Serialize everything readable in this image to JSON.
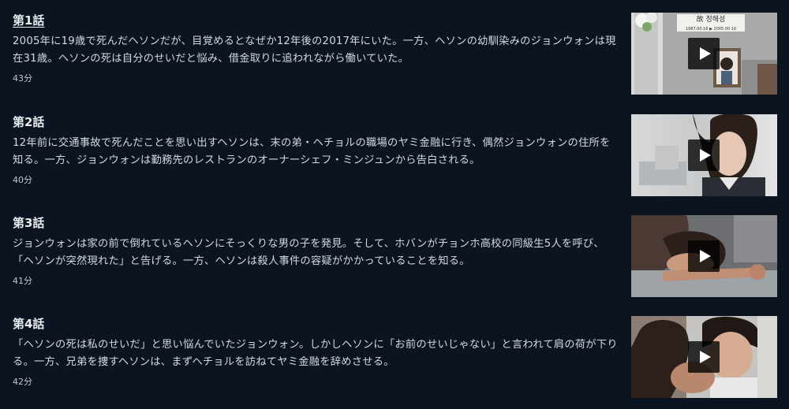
{
  "episodes": [
    {
      "title": "第1話",
      "description": "2005年に19歳で死んだヘソンだが、目覚めるとなぜか12年後の2017年にいた。一方、ヘソンの幼馴染みのジョンウォンは現在31歳。ヘソンの死は自分のせいだと悩み、借金取りに追われながら働いていた。",
      "duration": "43分",
      "thumbnail_plaque": "故 정해성",
      "thumbnail_dates": "1987.00.16 ▶ 2005.00.16"
    },
    {
      "title": "第2話",
      "description": "12年前に交通事故で死んだことを思い出すヘソンは、末の弟・ヘチョルの職場のヤミ金融に行き、偶然ジョンウォンの住所を知る。一方、ジョンウォンは勤務先のレストランのオーナーシェフ・ミンジュンから告白される。",
      "duration": "40分"
    },
    {
      "title": "第3話",
      "description": "ジョンウォンは家の前で倒れているヘソンにそっくりな男の子を発見。そして、ホバンがチョンホ高校の同級生5人を呼び、「ヘソンが突然現れた」と告げる。一方、ヘソンは殺人事件の容疑がかかっていることを知る。",
      "duration": "41分"
    },
    {
      "title": "第4話",
      "description": "「ヘソンの死は私のせいだ」と思い悩んでいたジョンウォン。しかしヘソンに「お前のせいじゃない」と言われて肩の荷が下りる。一方、兄弟を捜すヘソンは、まずヘチョルを訪ねてヤミ金融を辞めさせる。",
      "duration": "42分"
    }
  ],
  "icons": {
    "play": "play-icon"
  },
  "colors": {
    "background": "#0b1420",
    "text": "#d4d8de",
    "title": "#e8ecf0"
  }
}
